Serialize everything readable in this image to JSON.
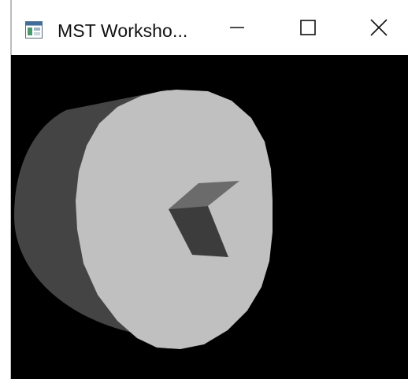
{
  "window": {
    "title": "MST Worksho...",
    "icon": "app-window-icon",
    "controls": {
      "minimize_icon": "minimize-icon",
      "maximize_icon": "maximize-icon",
      "close_icon": "close-icon"
    }
  },
  "viewport": {
    "background_color": "#000000",
    "cylinder_side_color": "#444444",
    "cylinder_face_color": "#c0c0c0",
    "cube_top_color": "#6b6b6b",
    "cube_side_color": "#3c3c3c"
  }
}
